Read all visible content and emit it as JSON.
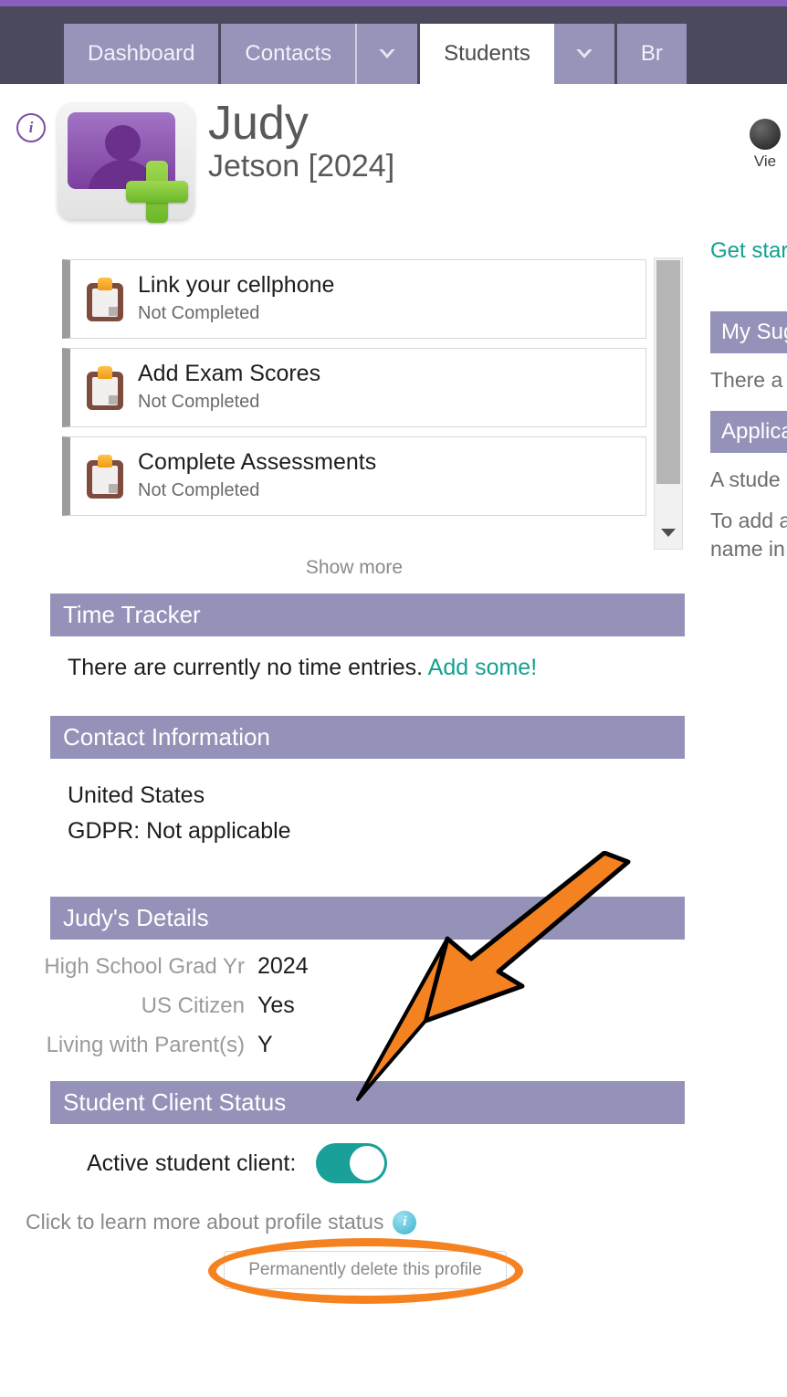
{
  "navbar": {
    "tabs": [
      {
        "label": "Dashboard",
        "active": false,
        "type": "tab"
      },
      {
        "label": "Contacts",
        "active": false,
        "type": "tab"
      },
      {
        "label": "",
        "active": false,
        "type": "caret",
        "icon": "chevron-down-icon"
      },
      {
        "label": "Students",
        "active": true,
        "type": "tab"
      },
      {
        "label": "",
        "active": false,
        "type": "caret",
        "icon": "chevron-down-icon"
      },
      {
        "label": "Br",
        "active": false,
        "type": "tab"
      }
    ]
  },
  "header": {
    "info_badge": "i",
    "avatar_icon": "add-person-avatar-icon",
    "first_name": "Judy",
    "last_name": "Jetson [2024]"
  },
  "right_rail": {
    "avatar_icon": "user-photo-icon",
    "view_label": "Vie",
    "get_started_link": "Get star",
    "suggestions_heading": "My Sug",
    "suggestions_text": "There a",
    "applications_heading": "Applica",
    "applications_text": "A stude",
    "applications_text2": "To add a\nname in"
  },
  "checklist": {
    "ghost_line": "",
    "items": [
      {
        "icon": "clipboard-icon",
        "title": "Link your cellphone",
        "status": "Not Completed"
      },
      {
        "icon": "clipboard-icon",
        "title": "Add Exam Scores",
        "status": "Not Completed"
      },
      {
        "icon": "clipboard-icon",
        "title": "Complete Assessments",
        "status": "Not Completed"
      }
    ],
    "show_more_label": "Show more",
    "scrollbar_arrow_icon": "scroll-down-arrow-icon"
  },
  "time_tracker": {
    "heading": "Time Tracker",
    "empty_text": "There are currently no time entries.",
    "add_link": "Add some!"
  },
  "contact_information": {
    "heading": "Contact Information",
    "country": "United States",
    "gdpr": "GDPR:  Not applicable"
  },
  "details": {
    "heading": "Judy's Details",
    "rows": [
      {
        "label": "High School Grad Yr",
        "value": "2024"
      },
      {
        "label": "US Citizen",
        "value": "Yes"
      },
      {
        "label": "Living with Parent(s)",
        "value": "Y"
      }
    ]
  },
  "student_client_status": {
    "heading": "Student Client Status",
    "toggle_label": "Active student client:",
    "toggle_on": true,
    "learn_more_text": "Click to learn more about profile status",
    "info_icon": "info-circle-icon",
    "delete_button_label": "Permanently delete this profile"
  },
  "annotations": {
    "arrow_color": "#f58220",
    "ellipse_color": "#f58220",
    "arrow_target": "Student Client Status"
  },
  "colors": {
    "top_strip": "#8b5fc0",
    "navbar": "#4a4a5c",
    "tab": "#9694b9",
    "section_header": "#9492b8",
    "teal_link": "#14a08f",
    "toggle_on": "#19a199",
    "annotation_orange": "#f58220"
  }
}
